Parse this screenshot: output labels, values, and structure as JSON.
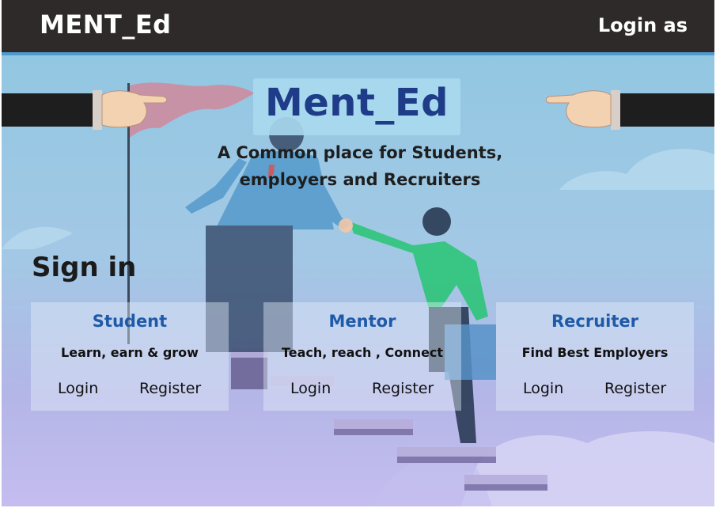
{
  "header": {
    "brand": "MENT_Ed",
    "login_as": "Login as"
  },
  "hero": {
    "title": "Ment_Ed",
    "tagline_line1": "A Common place for Students,",
    "tagline_line2": "employers and Recruiters",
    "signin_heading": "Sign in"
  },
  "cards": [
    {
      "role": "Student",
      "description": "Learn, earn & grow",
      "login": "Login",
      "register": "Register"
    },
    {
      "role": "Mentor",
      "description": "Teach, reach , Connect",
      "login": "Login",
      "register": "Register"
    },
    {
      "role": "Recruiter",
      "description": "Find Best Employers",
      "login": "Login",
      "register": "Register"
    }
  ],
  "colors": {
    "header_bg": "#2e2a29",
    "accent_line": "#4f9bd0",
    "title_blue": "#1f3c88",
    "role_blue": "#1f5aa8"
  }
}
